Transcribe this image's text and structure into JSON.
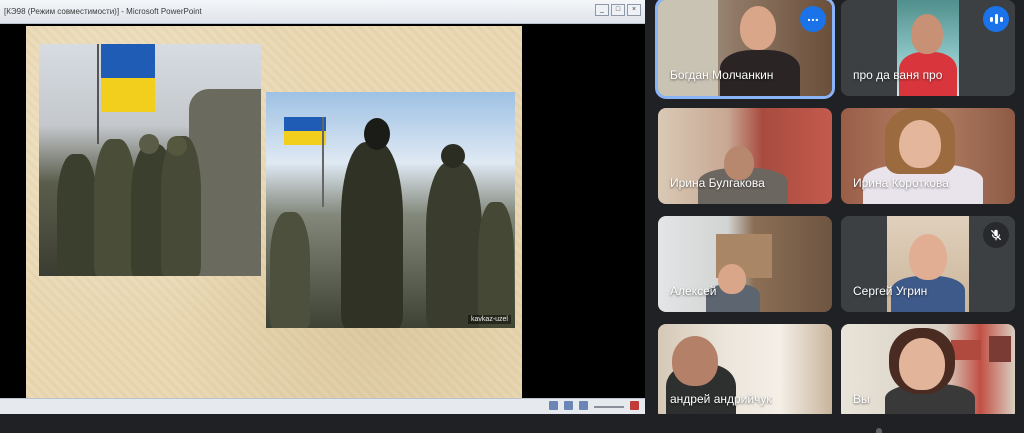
{
  "presentation": {
    "window_title": "[КЭ98 (Режим совместимости)] - Microsoft PowerPoint",
    "window_buttons": [
      "_",
      "□",
      "×"
    ],
    "slide_watermark": "kavkaz-uzel"
  },
  "participants": [
    {
      "name": "Богдан Молчанкин",
      "status_icon": "more-options-icon",
      "active": true
    },
    {
      "name": "про да ваня про",
      "status_icon": "audio-level-icon",
      "active": false
    },
    {
      "name": "Ирина Булгакова",
      "status_icon": "",
      "active": false
    },
    {
      "name": "Ирина Короткова",
      "status_icon": "",
      "active": false
    },
    {
      "name": "Алексей",
      "status_icon": "",
      "active": false
    },
    {
      "name": "Сергей Угрин",
      "status_icon": "mic-off-icon",
      "active": false
    },
    {
      "name": "андрей андрийчук",
      "status_icon": "",
      "active": false
    },
    {
      "name": "Вы",
      "status_icon": "",
      "active": false
    }
  ],
  "colors": {
    "accent": "#8ab4f8",
    "meet_bg": "#202124",
    "tile_bg": "#3c4043",
    "badge_blue": "#1a73e8"
  }
}
